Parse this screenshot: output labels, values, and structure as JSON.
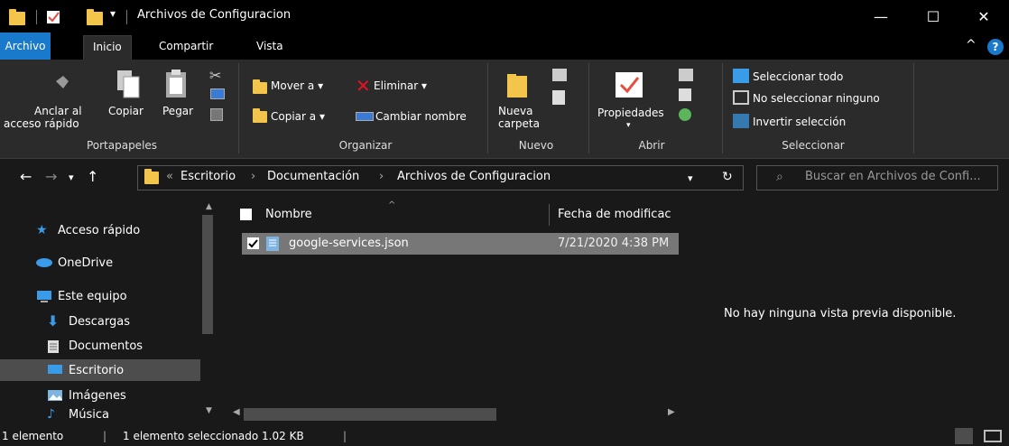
{
  "window": {
    "title": "Archivos de Configuracion",
    "minimize_glyph": "—",
    "maximize_glyph": "☐",
    "close_glyph": "✕"
  },
  "ribbon_tabs": [
    {
      "label": "Archivo"
    },
    {
      "label": "Inicio"
    },
    {
      "label": "Compartir"
    },
    {
      "label": "Vista"
    }
  ],
  "ribbon": {
    "portapapeles": {
      "anclar": "Anclar al",
      "anclar2": "acceso rápido",
      "copiar": "Copiar",
      "pegar": "Pegar",
      "label": "Portapapeles"
    },
    "organizar": {
      "mover": "Mover a ▾",
      "copiar_a": "Copiar a ▾",
      "eliminar": "Eliminar ▾",
      "cambiar": "Cambiar nombre",
      "label": "Organizar"
    },
    "nuevo": {
      "nueva": "Nueva",
      "carpeta": "carpeta",
      "label": "Nuevo"
    },
    "abrir": {
      "propiedades": "Propiedades",
      "label": "Abrir"
    },
    "seleccionar": {
      "todo": "Seleccionar todo",
      "ninguno": "No seleccionar ninguno",
      "invertir": "Invertir selección",
      "label": "Seleccionar"
    }
  },
  "address": {
    "crumbs": [
      "Escritorio",
      "Documentación",
      "Archivos de Configuracion"
    ],
    "prefix": "«",
    "search_placeholder": "Buscar en Archivos de Confi..."
  },
  "nav_pane": [
    {
      "label": "Acceso rápido",
      "icon": "star-icon"
    },
    {
      "label": "OneDrive",
      "icon": "cloud-icon"
    },
    {
      "label": "Este equipo",
      "icon": "computer-icon"
    },
    {
      "label": "Descargas",
      "icon": "download-icon"
    },
    {
      "label": "Documentos",
      "icon": "documents-icon"
    },
    {
      "label": "Escritorio",
      "icon": "desktop-icon",
      "selected": true
    },
    {
      "label": "Imágenes",
      "icon": "images-icon"
    },
    {
      "label": "Música",
      "icon": "music-icon"
    }
  ],
  "file_list": {
    "columns": [
      "Nombre",
      "Fecha de modificac"
    ],
    "rows": [
      {
        "name": "google-services.json",
        "modified": "7/21/2020 4:38 PM",
        "checked": true
      }
    ]
  },
  "preview": {
    "message": "No hay ninguna vista previa disponible."
  },
  "status": {
    "count": "1 elemento",
    "selected": "1 elemento seleccionado  1.02 KB"
  },
  "colors": {
    "accent": "#1979ca",
    "folder": "#f3c54b",
    "delete_red": "#e81123"
  }
}
